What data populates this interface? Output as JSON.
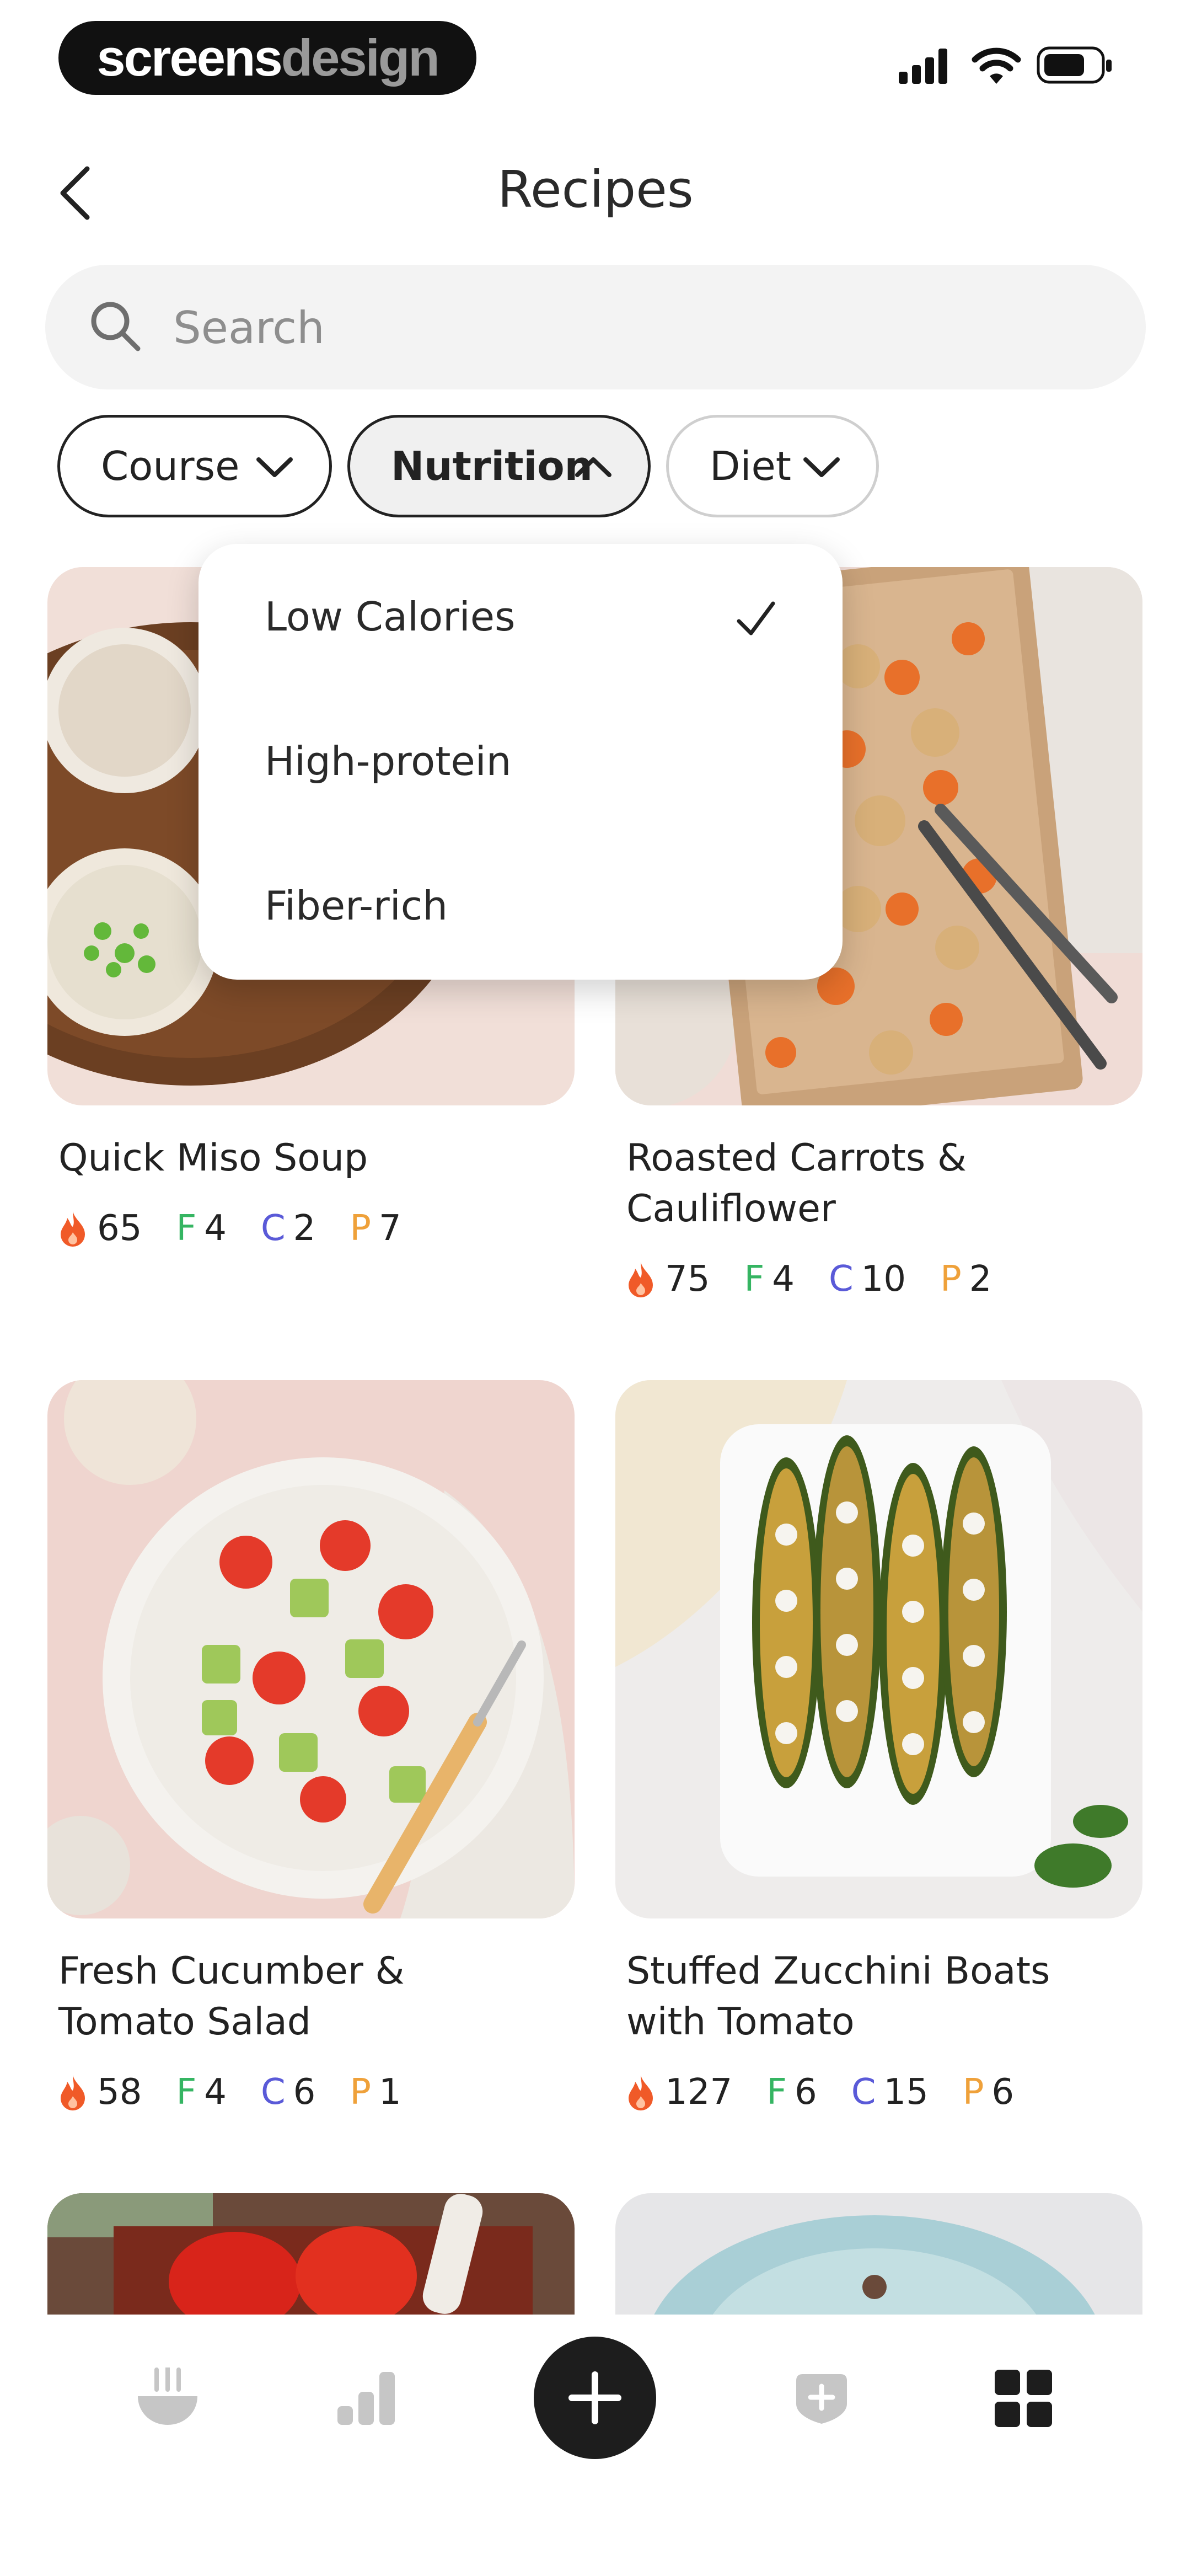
{
  "status_bar": {
    "logo_part1": "screens",
    "logo_part2": "design"
  },
  "header": {
    "title": "Recipes"
  },
  "search": {
    "placeholder": "Search"
  },
  "filters": [
    {
      "label": "Course",
      "state": "collapsed"
    },
    {
      "label": "Nutrition",
      "state": "expanded"
    },
    {
      "label": "Diet",
      "state": "collapsed"
    }
  ],
  "dropdown": {
    "items": [
      {
        "label": "Low Calories",
        "selected": true
      },
      {
        "label": "High-protein",
        "selected": false
      },
      {
        "label": "Fiber-rich",
        "selected": false
      }
    ]
  },
  "recipes": [
    {
      "title_line1": "Quick Miso Soup",
      "title_line2": "",
      "calories": "65",
      "f": "4",
      "c": "2",
      "p": "7"
    },
    {
      "title_line1": "Roasted Carrots &",
      "title_line2": "Cauliflower",
      "calories": "75",
      "f": "4",
      "c": "10",
      "p": "2"
    },
    {
      "title_line1": "Fresh Cucumber &",
      "title_line2": "Tomato Salad",
      "calories": "58",
      "f": "4",
      "c": "6",
      "p": "1"
    },
    {
      "title_line1": "Stuffed Zucchini Boats",
      "title_line2": "with Tomato",
      "calories": "127",
      "f": "6",
      "c": "15",
      "p": "6"
    }
  ],
  "macro_letters": {
    "f": "F",
    "c": "C",
    "p": "P"
  },
  "bottom_nav": {
    "items": [
      "bowl-icon",
      "stats-icon",
      "add-icon",
      "badge-icon",
      "grid-icon"
    ],
    "active": "grid-icon"
  },
  "colors": {
    "fat": "#35b562",
    "carbs": "#5a5ad8",
    "protein": "#efa13a",
    "flame": "#f05a28"
  }
}
